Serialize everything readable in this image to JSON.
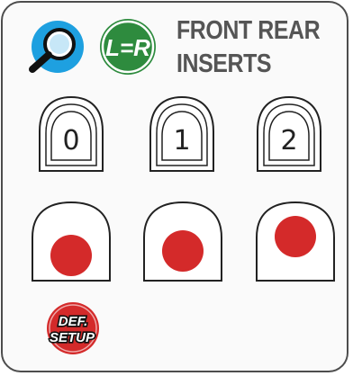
{
  "title": {
    "line1": "FRONT REAR",
    "line2": "INSERTS"
  },
  "icons": {
    "zoom": "magnifier-icon",
    "link": "L=R",
    "link_color": "#2e8b3e",
    "zoom_color": "#1ea0e0"
  },
  "inserts": [
    {
      "label": "0"
    },
    {
      "label": "1"
    },
    {
      "label": "2"
    }
  ],
  "positions": [
    {
      "name": "position-left"
    },
    {
      "name": "position-center"
    },
    {
      "name": "position-right"
    }
  ],
  "reset": {
    "line1": "DEF.",
    "line2": "SETUP",
    "color": "#d42a2a"
  },
  "colors": {
    "accent_red": "#d42a2a",
    "title_gray": "#555555"
  }
}
